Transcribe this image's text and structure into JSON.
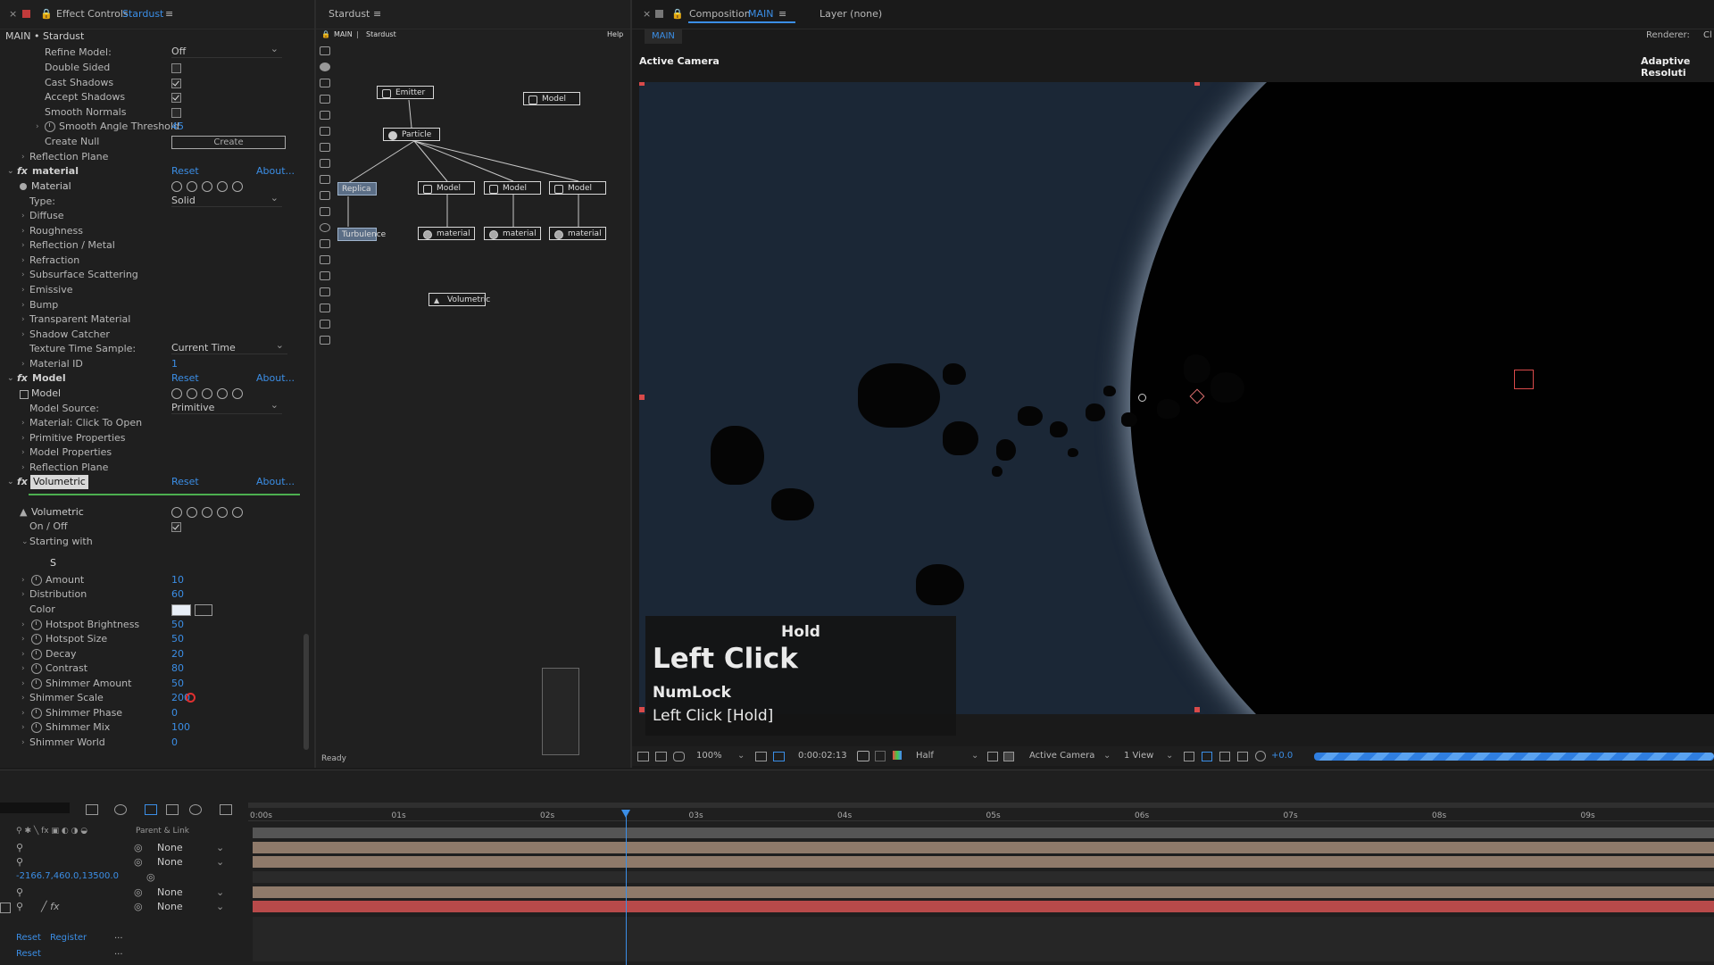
{
  "effect_controls": {
    "close": "×",
    "title": "Effect Controls",
    "effect": "Stardust",
    "menu": "≡",
    "breadcrumb": "MAIN • Stardust",
    "rows": {
      "refine_model": {
        "label": "Refine Model:",
        "value": "Off"
      },
      "double_sided": "Double Sided",
      "cast_shadows": "Cast Shadows",
      "accept_shadows": "Accept Shadows",
      "smooth_normals": "Smooth Normals",
      "smooth_angle": {
        "label": "Smooth Angle Threshold",
        "value": "45"
      },
      "create_null": {
        "label": "Create Null",
        "button": "Create"
      },
      "reflection_plane": "Reflection Plane",
      "material_fx": {
        "label": "material",
        "reset": "Reset",
        "about": "About..."
      },
      "material": "Material",
      "type": {
        "label": "Type:",
        "value": "Solid"
      },
      "diffuse": "Diffuse",
      "roughness": "Roughness",
      "reflection_metal": "Reflection / Metal",
      "refraction": "Refraction",
      "subsurface": "Subsurface Scattering",
      "emissive": "Emissive",
      "bump": "Bump",
      "transparent": "Transparent Material",
      "shadow_catcher": "Shadow Catcher",
      "texture_time": {
        "label": "Texture Time Sample:",
        "value": "Current Time"
      },
      "material_id": {
        "label": "Material ID",
        "value": "1"
      },
      "model_fx": {
        "label": "Model",
        "reset": "Reset",
        "about": "About..."
      },
      "model": "Model",
      "model_source": {
        "label": "Model Source:",
        "value": "Primitive"
      },
      "material_click": "Material: Click To Open",
      "primitive_props": "Primitive Properties",
      "model_props": "Model Properties",
      "reflection_plane2": "Reflection Plane",
      "volumetric_fx": {
        "label": "Volumetric",
        "reset": "Reset",
        "about": "About..."
      },
      "volumetric": "Volumetric",
      "on_off": "On / Off",
      "starting_with": "Starting with",
      "s_label": "S",
      "amount": {
        "label": "Amount",
        "value": "10"
      },
      "distribution": {
        "label": "Distribution",
        "value": "60"
      },
      "color": "Color",
      "hotspot_brightness": {
        "label": "Hotspot Brightness",
        "value": "50"
      },
      "hotspot_size": {
        "label": "Hotspot Size",
        "value": "50"
      },
      "decay": {
        "label": "Decay",
        "value": "20"
      },
      "contrast": {
        "label": "Contrast",
        "value": "80"
      },
      "shimmer_amount": {
        "label": "Shimmer Amount",
        "value": "50"
      },
      "shimmer_scale": {
        "label": "Shimmer Scale",
        "value": "200"
      },
      "shimmer_phase": {
        "label": "Shimmer Phase",
        "value": "0"
      },
      "shimmer_mix": {
        "label": "Shimmer Mix",
        "value": "100"
      },
      "shimmer_world": {
        "label": "Shimmer World",
        "value": "0"
      }
    }
  },
  "node_panel": {
    "title": "Stardust",
    "menu": "≡",
    "crumb_main": "MAIN",
    "crumb_sep": "|",
    "crumb_stardust": "Stardust",
    "help": "Help",
    "status": "Ready",
    "nodes": {
      "emitter": "Emitter",
      "model_top": "Model",
      "particle": "Particle",
      "replica": "Replica",
      "turbulence": "Turbulence",
      "model1": "Model",
      "model2": "Model",
      "model3": "Model",
      "material1": "material",
      "material2": "material",
      "material3": "material",
      "volumetric": "Volumetric"
    }
  },
  "composition": {
    "close": "×",
    "label": "Composition",
    "name": "MAIN",
    "menu": "≡",
    "layer": "Layer (none)",
    "tab": "MAIN",
    "renderer": "Renderer:",
    "renderer_val": "Cl",
    "active_camera": "Active Camera",
    "adaptive": "Adaptive Resoluti",
    "bottom": {
      "zoom": "100%",
      "timecode": "0:00:02:13",
      "resolution": "Half",
      "camera": "Active Camera",
      "views": "1 View",
      "exposure": "+0.0"
    }
  },
  "overlay": {
    "hold": "Hold",
    "main": "Left Click",
    "key": "NumLock",
    "detail": "Left Click [Hold]"
  },
  "timeline": {
    "ticks": [
      "0:00s",
      "01s",
      "02s",
      "03s",
      "04s",
      "05s",
      "06s",
      "07s",
      "08s",
      "09s"
    ],
    "parent_link": "Parent & Link",
    "none": "None",
    "coords": "-2166.7,460.0,13500.0",
    "reset1": "Reset",
    "register": "Register",
    "dots1": "...",
    "reset2": "Reset",
    "dots2": "...",
    "playhead_fraction": 0.255
  },
  "colors": {
    "accent": "#3b8ee6",
    "track_tan": "#8f7a6a",
    "track_red": "#b84a4a",
    "track_grey": "#4a4a4a"
  }
}
